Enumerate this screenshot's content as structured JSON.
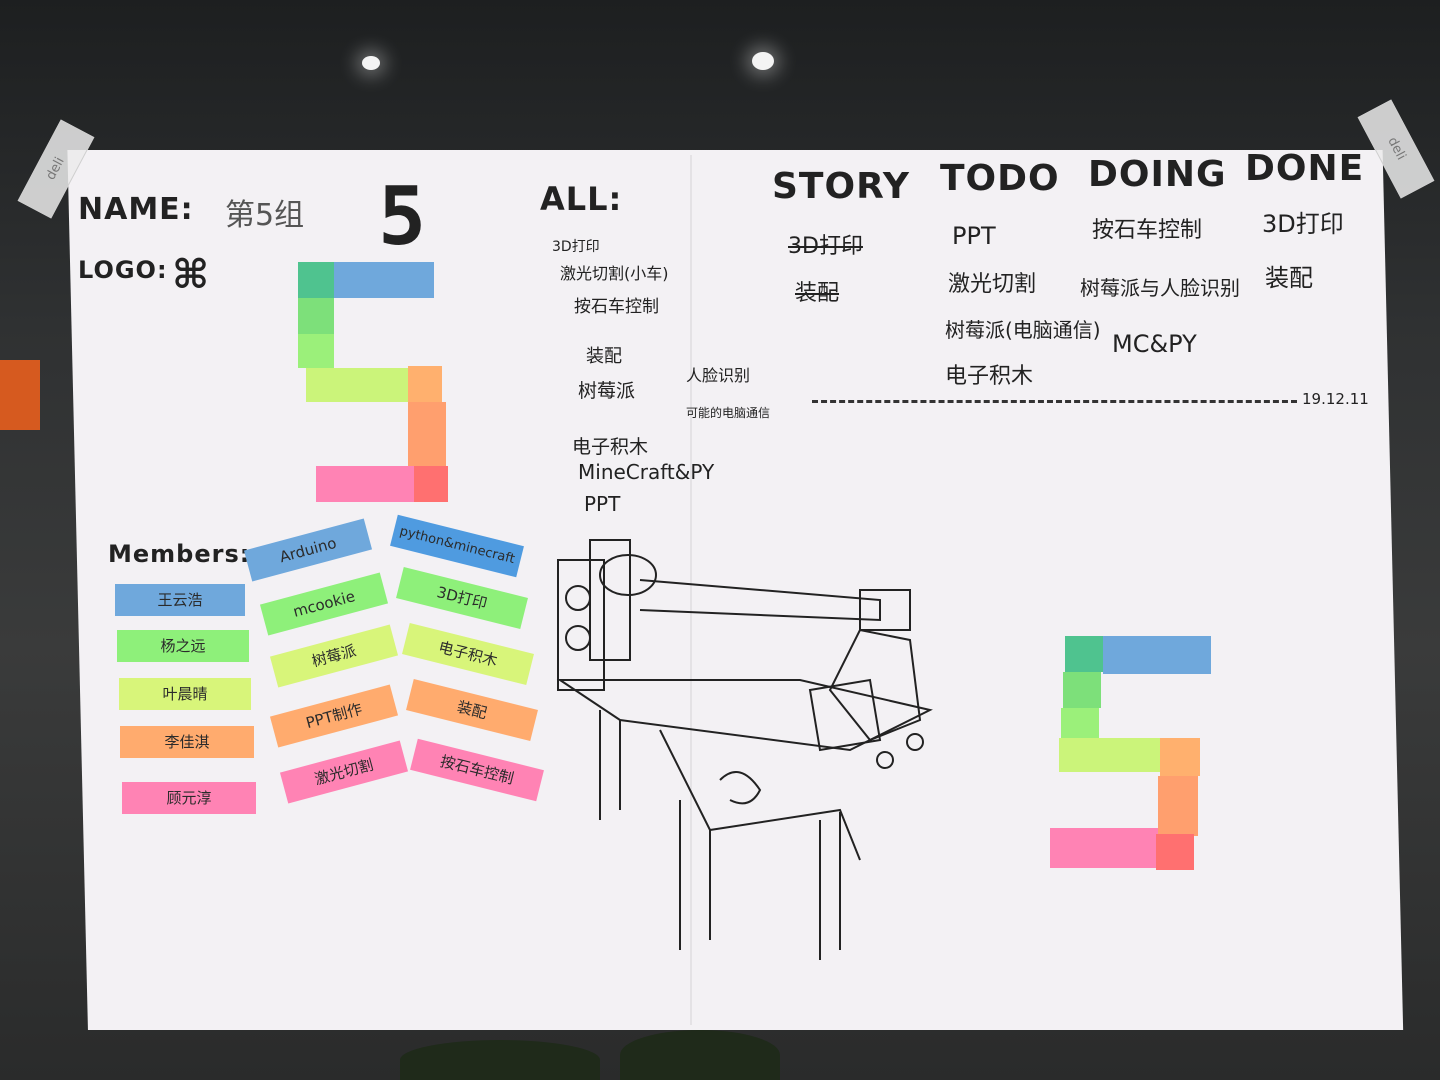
{
  "header": {
    "name_label": "NAME:",
    "name_value": "第5组",
    "logo_label": "LOGO:",
    "all_label": "ALL:"
  },
  "board": {
    "columns": [
      {
        "title": "STORY",
        "items": [
          "3D打印",
          "装配"
        ]
      },
      {
        "title": "TODO",
        "items": [
          "PPT",
          "激光切割",
          "树莓派(电脑通信)",
          "电子积木"
        ]
      },
      {
        "title": "DOING",
        "items": [
          "按石车控制",
          "树莓派与人脸识别",
          "MC&PY"
        ]
      },
      {
        "title": "DONE",
        "items": [
          "3D打印",
          "装配"
        ]
      }
    ],
    "date": "19.12.11"
  },
  "all_tasks": [
    "3D打印",
    "激光切割(小车)",
    "按石车控制",
    "装配",
    "树莓派",
    "人脸识别",
    "可能的电脑通信",
    "电子积木",
    "MineCraft&PY",
    "PPT"
  ],
  "members_label": "Members:",
  "members": [
    {
      "name": "王云浩",
      "color": "#6fa8dc"
    },
    {
      "name": "杨之远",
      "color": "#8ef07a"
    },
    {
      "name": "叶晨晴",
      "color": "#d8f57a"
    },
    {
      "name": "李佳淇",
      "color": "#ffab6e"
    },
    {
      "name": "顾元淳",
      "color": "#ff83b4"
    }
  ],
  "skills_col1": [
    {
      "text": "Arduino",
      "color": "#6fa8dc"
    },
    {
      "text": "mcookie",
      "color": "#8ef07a"
    },
    {
      "text": "树莓派",
      "color": "#d8f57a"
    },
    {
      "text": "PPT制作",
      "color": "#ffab6e"
    },
    {
      "text": "激光切割",
      "color": "#ff83b4"
    }
  ],
  "skills_col2": [
    {
      "text": "python&minecraft",
      "color": "#4f9be0"
    },
    {
      "text": "3D打印",
      "color": "#8ef07a"
    },
    {
      "text": "电子积木",
      "color": "#d8f57a"
    },
    {
      "text": "装配",
      "color": "#ffab6e"
    },
    {
      "text": "按石车控制",
      "color": "#ff83b4"
    }
  ],
  "tape_text": "deli",
  "colors": {
    "blue": "#6fa8dc",
    "green": "#8ef07a",
    "lime": "#d8f57a",
    "orange": "#ffab6e",
    "pink": "#ff83b4",
    "paper": "#f3f1f4"
  }
}
